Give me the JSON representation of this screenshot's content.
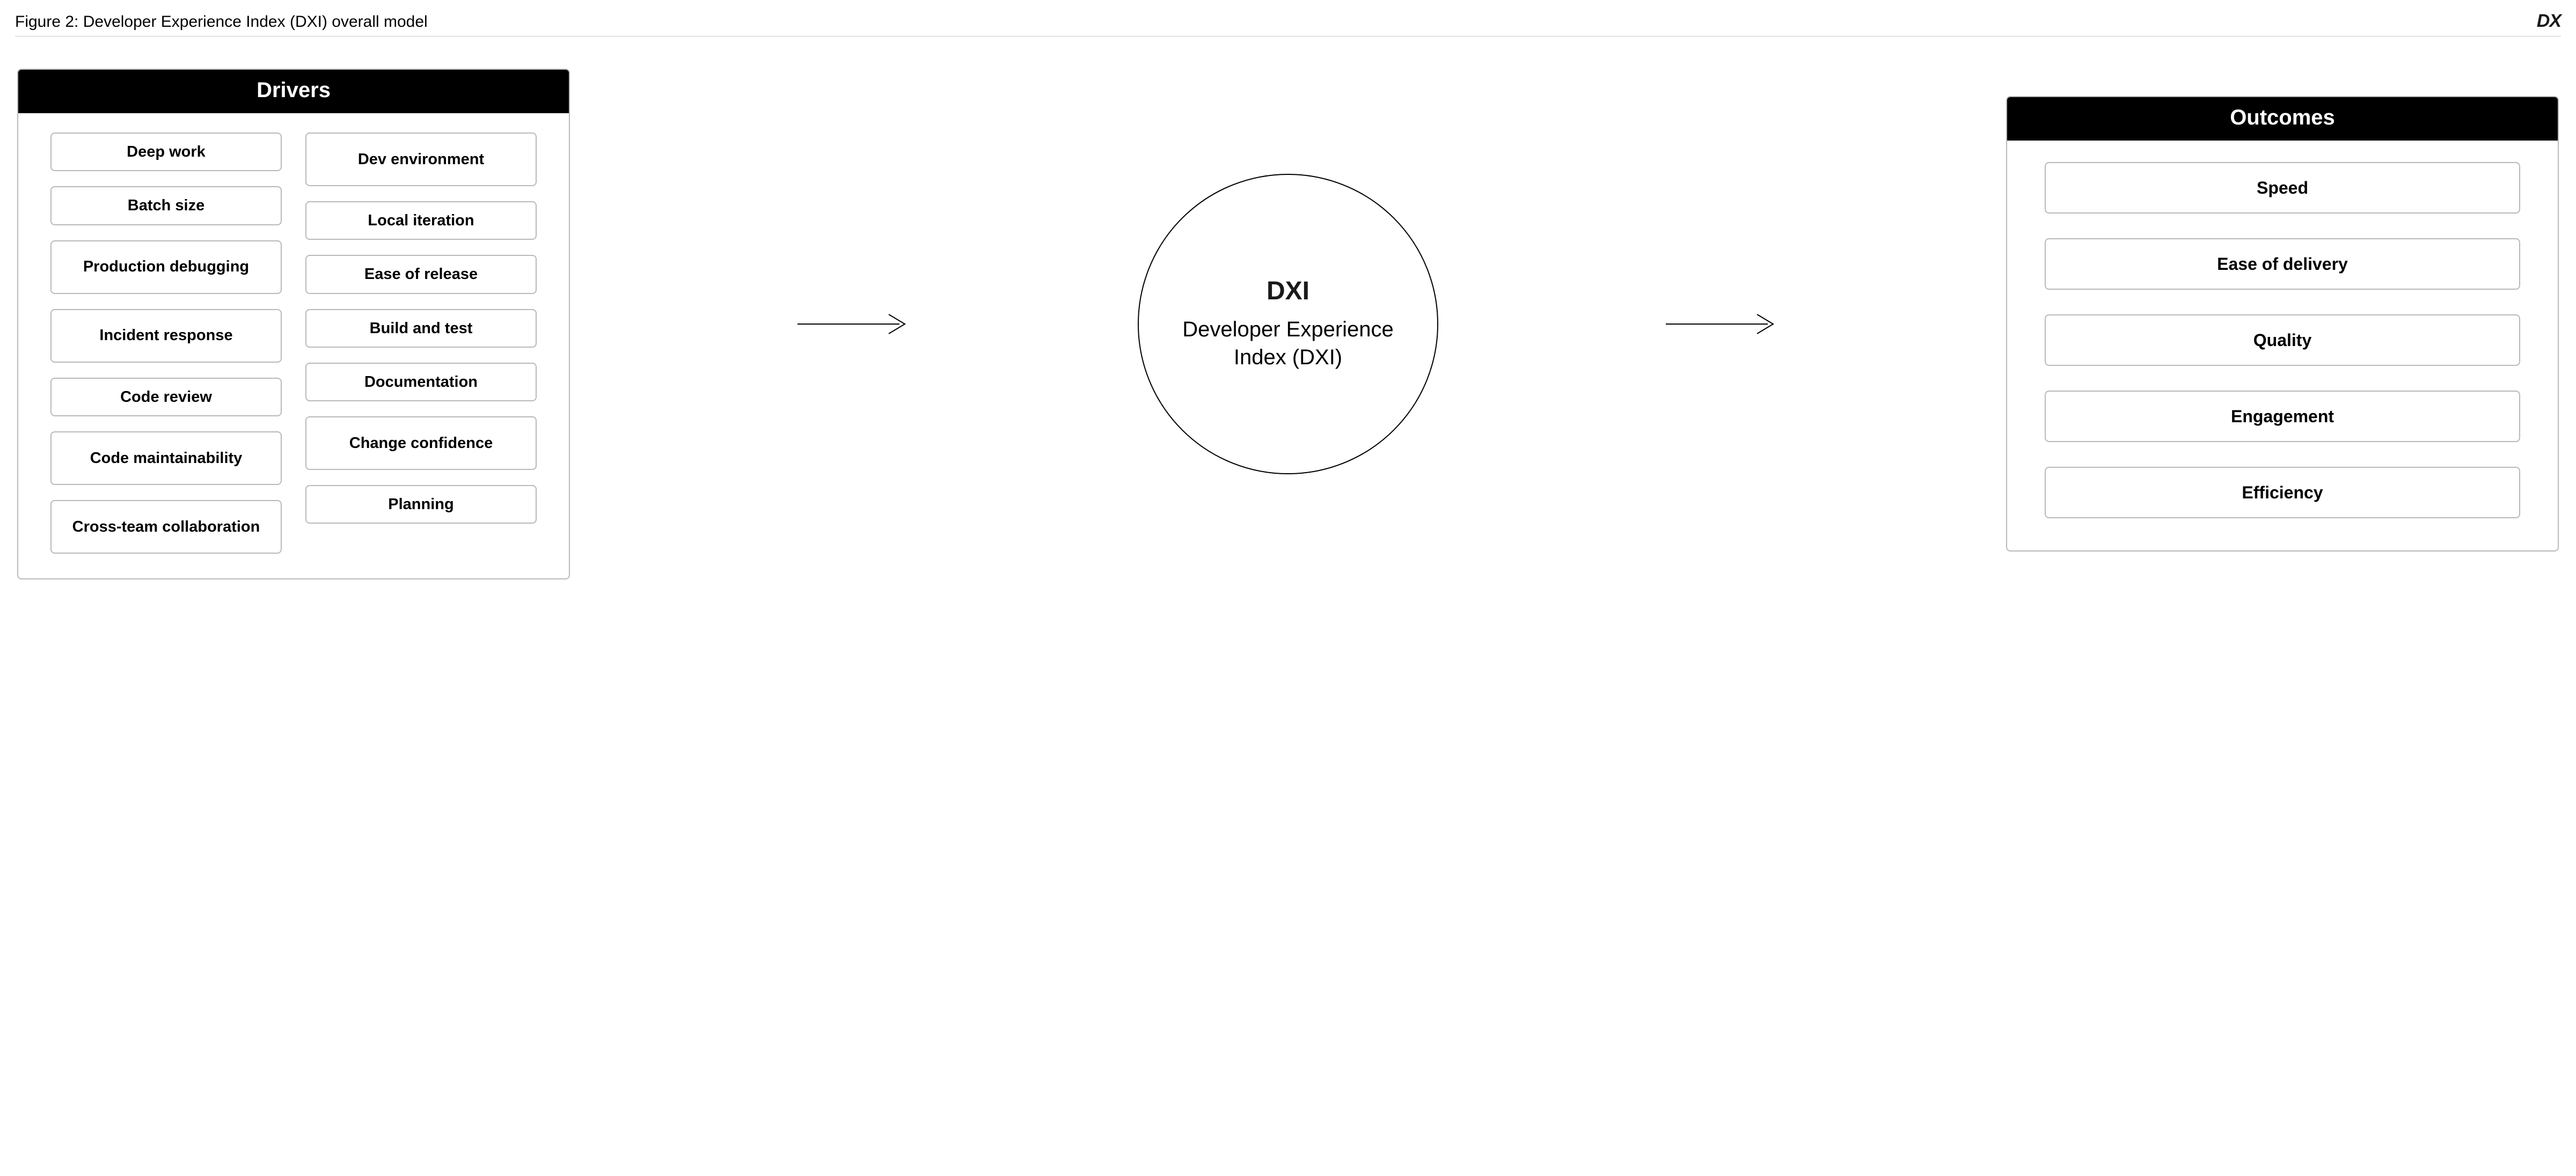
{
  "figure_title": "Figure 2: Developer Experience Index (DXI) overall model",
  "corner_logo": "DX",
  "drivers": {
    "header": "Drivers",
    "col1": [
      "Deep work",
      "Batch size",
      "Production debugging",
      "Incident response",
      "Code review",
      "Code maintainability",
      "Cross-team collaboration"
    ],
    "col2": [
      "Dev environment",
      "Local iteration",
      "Ease of release",
      "Build and test",
      "Documentation",
      "Change confidence",
      "Planning"
    ]
  },
  "center": {
    "logo": "DXI",
    "label": "Developer Experience Index (DXI)"
  },
  "outcomes": {
    "header": "Outcomes",
    "items": [
      "Speed",
      "Ease of delivery",
      "Quality",
      "Engagement",
      "Efficiency"
    ]
  }
}
